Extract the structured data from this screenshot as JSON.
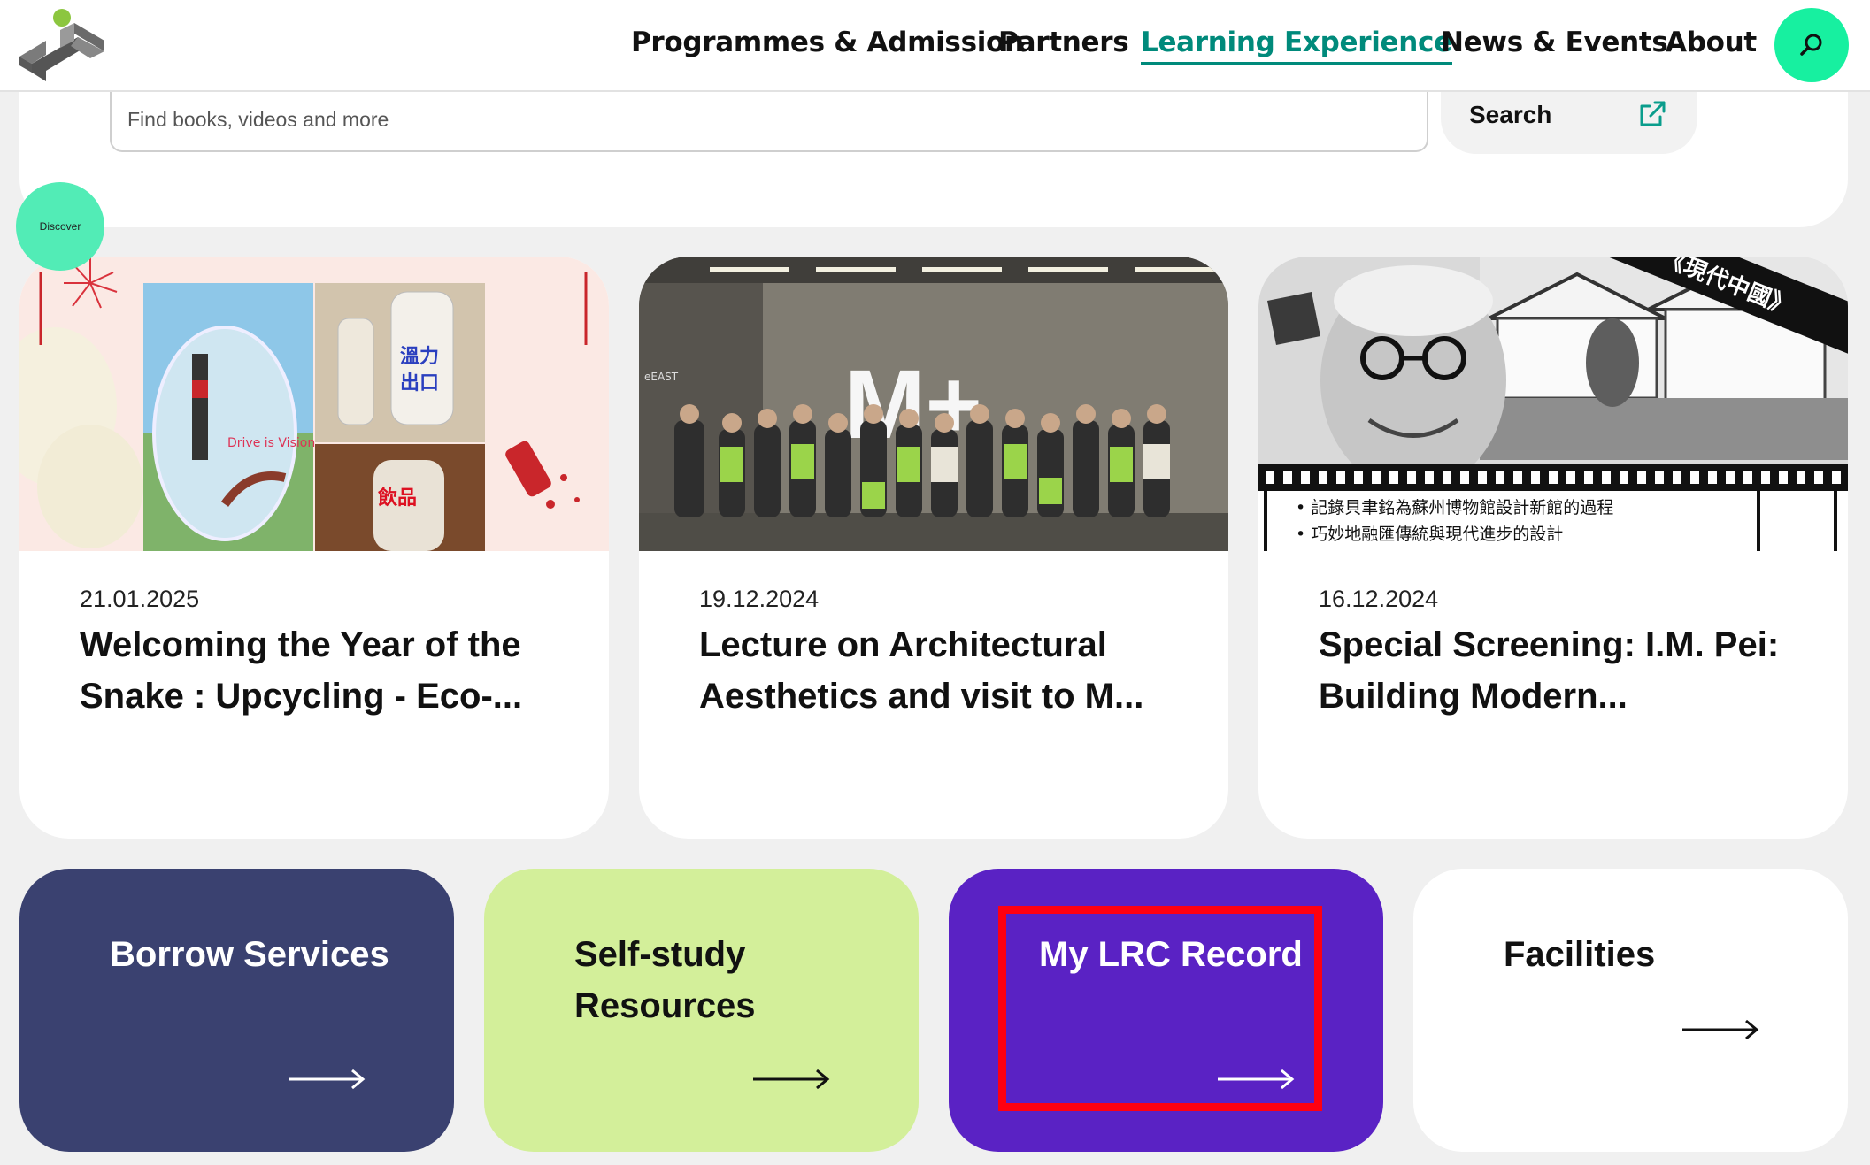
{
  "nav": {
    "items": [
      {
        "label": "Programmes & Admission",
        "active": false
      },
      {
        "label": "Partners",
        "active": false
      },
      {
        "label": "Learning Experience",
        "active": true
      },
      {
        "label": "News & Events",
        "active": false
      },
      {
        "label": "About",
        "active": false
      }
    ],
    "search_icon": "search-icon"
  },
  "search": {
    "placeholder": "Find books, videos and more",
    "button_label": "Search",
    "button_icon": "external-link-icon"
  },
  "discover_label": "Discover",
  "cards": [
    {
      "date": "21.01.2025",
      "title": "Welcoming the Year of the Snake : Upcycling - Eco-...",
      "image_labels": [
        "溫力",
        "出口",
        "飲品",
        "Drive is Vision"
      ]
    },
    {
      "date": "19.12.2024",
      "title": "Lecture on Architectural Aesthetics and visit to M...",
      "image_labels": [
        "M+",
        "eEAST"
      ]
    },
    {
      "date": "16.12.2024",
      "title": "Special Screening: I.M. Pei: Building Modern...",
      "image_labels": [
        "《現代中國》",
        "• 記錄貝聿銘為蘇州博物館設計新館的過程",
        "• 巧妙地融匯傳統與現代進步的設計"
      ]
    }
  ],
  "tiles": [
    {
      "label": "Borrow Services",
      "bg": "#3a4170",
      "fg": "#ffffff"
    },
    {
      "label": "Self-study Resources",
      "bg": "#d3ef9a",
      "fg": "#111111"
    },
    {
      "label": "My LRC Record",
      "bg": "#5a22c4",
      "fg": "#ffffff",
      "highlighted": true
    },
    {
      "label": "Facilities",
      "bg": "#ffffff",
      "fg": "#111111"
    }
  ],
  "colors": {
    "accent": "#008a7b",
    "search_circle": "#17f0a0",
    "discover": "#52ecb6",
    "highlight": "#ff0010"
  }
}
